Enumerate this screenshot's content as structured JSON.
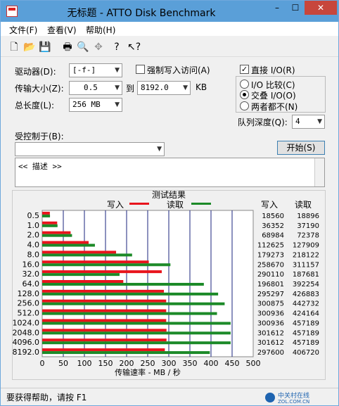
{
  "window": {
    "title": "无标题 - ATTO Disk Benchmark",
    "min": "–",
    "max": "☐",
    "close": "✕"
  },
  "menu": {
    "file": "文件(F)",
    "view": "查看(V)",
    "help": "帮助(H)"
  },
  "toolbar": [
    "new-icon",
    "open-icon",
    "save-icon",
    "print-icon",
    "print-preview-icon",
    "move-icon",
    "help-icon",
    "context-help-icon"
  ],
  "settings": {
    "drive_label": "驱动器(D):",
    "drive_value": "[-f-]",
    "force_write_label": "强制写入访问(A)",
    "transfer_label": "传输大小(Z):",
    "transfer_from": "0.5",
    "to_label": "到",
    "transfer_to": "8192.0",
    "unit_kb": "KB",
    "total_label": "总长度(L):",
    "total_value": "256 MB",
    "direct_io_label": "直接 I/O(R)",
    "io_compare_label": "I/O 比较(C)",
    "overlap_io_label": "交叠 I/O(O)",
    "neither_label": "两者都不(N)",
    "queue_label": "队列深度(Q):",
    "queue_value": "4",
    "controlled_label": "受控制于(B):",
    "controlled_value": "",
    "start_button": "开始(S)",
    "description": "<< 描述 >>"
  },
  "results": {
    "title": "测试结果",
    "legend_write": "写入",
    "legend_read": "读取",
    "col_write": "写入",
    "col_read": "读取",
    "xlabel": "传输速率 - MB / 秒"
  },
  "colors": {
    "write": "#e8141c",
    "read": "#1c8a28",
    "gridline": "#1a237e"
  },
  "chart_data": {
    "type": "bar",
    "categories": [
      "0.5",
      "1.0",
      "2.0",
      "4.0",
      "8.0",
      "16.0",
      "32.0",
      "64.0",
      "128.0",
      "256.0",
      "512.0",
      "1024.0",
      "2048.0",
      "4096.0",
      "8192.0"
    ],
    "series": [
      {
        "name": "写入",
        "values": [
          18560,
          36352,
          68984,
          112625,
          179273,
          258670,
          290110,
          196801,
          295297,
          300875,
          300936,
          300936,
          301612,
          301612,
          297600
        ]
      },
      {
        "name": "读取",
        "values": [
          18896,
          37190,
          72378,
          127909,
          218122,
          311157,
          187681,
          392254,
          426883,
          442732,
          424164,
          457189,
          457189,
          457189,
          406720
        ]
      }
    ],
    "xticks": [
      "0",
      "50",
      "100",
      "150",
      "200",
      "250",
      "300",
      "350",
      "400",
      "450",
      "500"
    ],
    "xlim": [
      0,
      500
    ]
  },
  "status": {
    "text": "要获得帮助，请按 F1",
    "watermark": "中关村在线 ZOL.COM.CN"
  }
}
